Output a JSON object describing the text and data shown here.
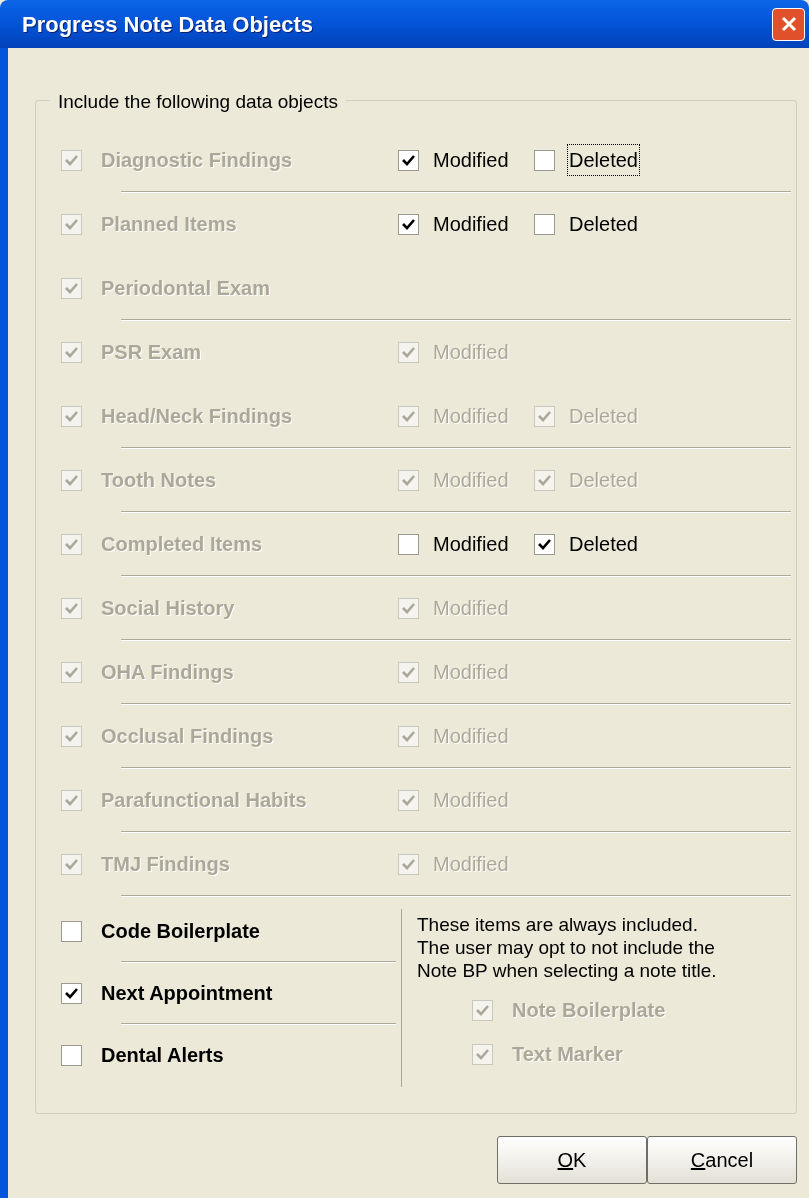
{
  "window": {
    "title": "Progress Note Data Objects"
  },
  "group": {
    "title": "Include the following data objects"
  },
  "objects": [
    {
      "label": "Diagnostic Findings",
      "checked": true,
      "disabled": true,
      "separator": true,
      "modified": {
        "label": "Modified",
        "checked": true,
        "disabled": false
      },
      "deleted": {
        "label": "Deleted",
        "checked": false,
        "disabled": false,
        "focused": true
      }
    },
    {
      "label": "Planned Items",
      "checked": true,
      "disabled": true,
      "separator": false,
      "modified": {
        "label": "Modified",
        "checked": true,
        "disabled": false
      },
      "deleted": {
        "label": "Deleted",
        "checked": false,
        "disabled": false,
        "focused": false
      }
    },
    {
      "label": "Periodontal Exam",
      "checked": true,
      "disabled": true,
      "separator": true
    },
    {
      "label": "PSR Exam",
      "checked": true,
      "disabled": true,
      "separator": false,
      "modified": {
        "label": "Modified",
        "checked": true,
        "disabled": true
      }
    },
    {
      "label": "Head/Neck Findings",
      "checked": true,
      "disabled": true,
      "separator": true,
      "modified": {
        "label": "Modified",
        "checked": true,
        "disabled": true
      },
      "deleted": {
        "label": "Deleted",
        "checked": true,
        "disabled": true,
        "focused": false
      }
    },
    {
      "label": "Tooth Notes",
      "checked": true,
      "disabled": true,
      "separator": true,
      "modified": {
        "label": "Modified",
        "checked": true,
        "disabled": true
      },
      "deleted": {
        "label": "Deleted",
        "checked": true,
        "disabled": true,
        "focused": false
      }
    },
    {
      "label": "Completed Items",
      "checked": true,
      "disabled": true,
      "separator": true,
      "modified": {
        "label": "Modified",
        "checked": false,
        "disabled": false
      },
      "deleted": {
        "label": "Deleted",
        "checked": true,
        "disabled": false,
        "focused": false
      }
    },
    {
      "label": "Social History",
      "checked": true,
      "disabled": true,
      "separator": true,
      "modified": {
        "label": "Modified",
        "checked": true,
        "disabled": true
      }
    },
    {
      "label": "OHA Findings",
      "checked": true,
      "disabled": true,
      "separator": true,
      "modified": {
        "label": "Modified",
        "checked": true,
        "disabled": true
      }
    },
    {
      "label": "Occlusal Findings",
      "checked": true,
      "disabled": true,
      "separator": true,
      "modified": {
        "label": "Modified",
        "checked": true,
        "disabled": true
      }
    },
    {
      "label": "Parafunctional Habits",
      "checked": true,
      "disabled": true,
      "separator": true,
      "modified": {
        "label": "Modified",
        "checked": true,
        "disabled": true
      }
    },
    {
      "label": "TMJ Findings",
      "checked": true,
      "disabled": true,
      "separator": true,
      "modified": {
        "label": "Modified",
        "checked": true,
        "disabled": true
      }
    }
  ],
  "extras": [
    {
      "label": "Code Boilerplate",
      "checked": false,
      "separator": true
    },
    {
      "label": "Next Appointment",
      "checked": true,
      "separator": true
    },
    {
      "label": "Dental Alerts",
      "checked": false,
      "separator": false
    }
  ],
  "always_included": {
    "note_lines": [
      "These items are always included.",
      "The user may opt to not include the",
      "Note BP when selecting a note title."
    ],
    "items": [
      {
        "label": "Note Boilerplate",
        "checked": true,
        "disabled": true
      },
      {
        "label": "Text Marker",
        "checked": true,
        "disabled": true
      }
    ]
  },
  "buttons": [
    {
      "accel": "O",
      "rest": "K"
    },
    {
      "accel": "C",
      "rest": "ancel"
    }
  ]
}
